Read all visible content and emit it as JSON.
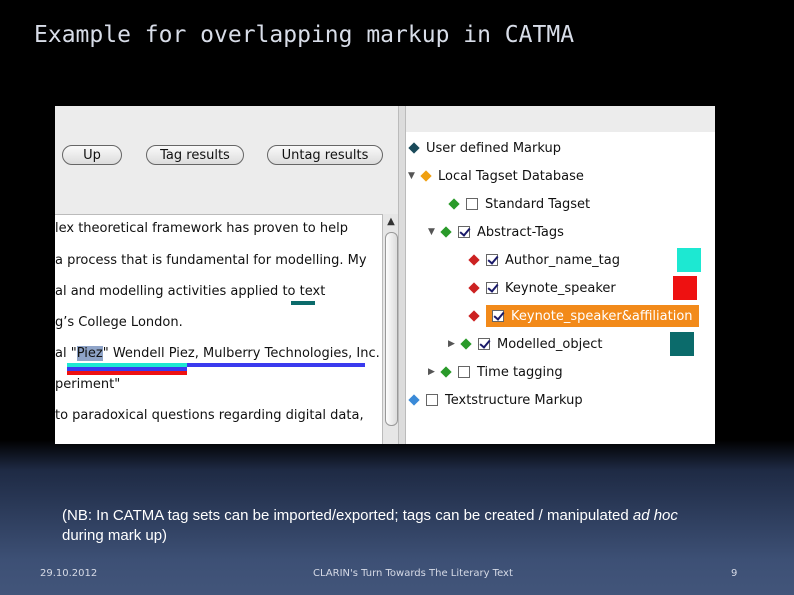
{
  "title": "Example for overlapping markup in CATMA",
  "toolbar": {
    "up": "Up",
    "tag_results": "Tag results",
    "untag_results": "Untag results"
  },
  "text_lines": [
    "lex theoretical framework has proven to help",
    " a process that is fundamental for modelling. My",
    "al and modelling activities applied to ",
    "g’s College London.",
    "al \"",
    "Piez",
    "\"  Wendell Piez, Mulberry Technologies, Inc.",
    "periment\"",
    "to paradoxical questions regarding digital data,",
    "                                     "
  ],
  "text_word_marked": "text",
  "tree": {
    "root": "User defined Markup",
    "local_db": "Local Tagset Database",
    "standard": "Standard Tagset",
    "abstract": "Abstract-Tags",
    "author": "Author_name_tag",
    "keynote": "Keynote_speaker",
    "keynote_aff": "Keynote_speaker&affiliation",
    "modelled": "Modelled_object",
    "time": "Time tagging",
    "textstructure": "Textstructure Markup"
  },
  "colors": {
    "author": "#1de8d2",
    "keynote": "#ee1111",
    "keynote_aff": "#3a3aee",
    "modelled": "#0b6b6b",
    "selected": "#f28a1a"
  },
  "note": {
    "before": "(NB: In CATMA tag sets can be imported/exported; tags can be created / manipulated ",
    "italic": "ad hoc",
    "after": " during mark up)"
  },
  "footer": {
    "date": "29.10.2012",
    "center": "CLARIN's Turn Towards The Literary Text",
    "page": "9"
  }
}
